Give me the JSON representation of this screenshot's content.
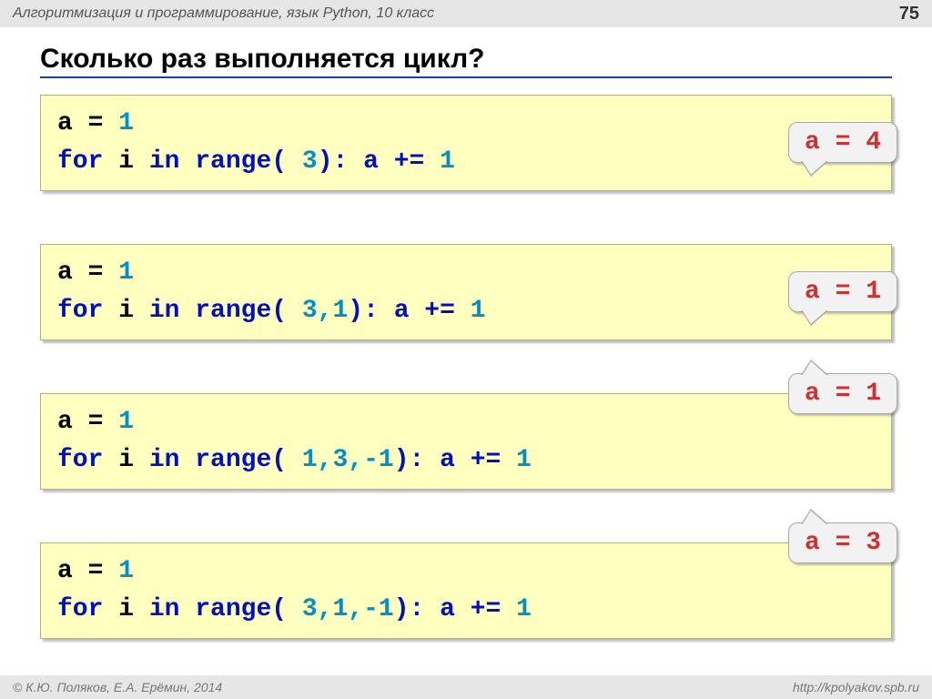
{
  "header": {
    "subject": "Алгоритмизация и программирование, язык Python, 10 класс",
    "page_number": "75"
  },
  "title": "Сколько раз выполняется цикл?",
  "blocks": [
    {
      "line1_var": "a",
      "line1_eq": " = ",
      "line1_val": "1",
      "kw_for": "for",
      "kw_var": " i ",
      "kw_in": "in",
      "kw_range": " range(",
      "args": " 3",
      "kw_close": "): a += ",
      "inc": "1",
      "answer": "a = 4",
      "answer_top": "30"
    },
    {
      "line1_var": "a",
      "line1_eq": " = ",
      "line1_val": "1",
      "kw_for": "for",
      "kw_var": " i ",
      "kw_in": "in",
      "kw_range": " range(",
      "args": " 3,1",
      "kw_close": "): a += ",
      "inc": "1",
      "answer": "a = 1",
      "answer_top": "30"
    },
    {
      "line1_var": "a",
      "line1_eq": " = ",
      "line1_val": "1",
      "kw_for": "for",
      "kw_var": " i ",
      "kw_in": "in",
      "kw_range": " range(",
      "args": " 1,3,-1",
      "kw_close": "): a += ",
      "inc": "1",
      "answer": "a = 1",
      "answer_top": "-22"
    },
    {
      "line1_var": "a",
      "line1_eq": " = ",
      "line1_val": "1",
      "kw_for": "for",
      "kw_var": " i ",
      "kw_in": "in",
      "kw_range": " range(",
      "args": " 3,1,-1",
      "kw_close": "): a += ",
      "inc": "1",
      "answer": "a = 3",
      "answer_top": "-22"
    }
  ],
  "footer": {
    "copyright": "© К.Ю. Поляков, Е.А. Ерёмин, 2014",
    "url": "http://kpolyakov.spb.ru"
  }
}
